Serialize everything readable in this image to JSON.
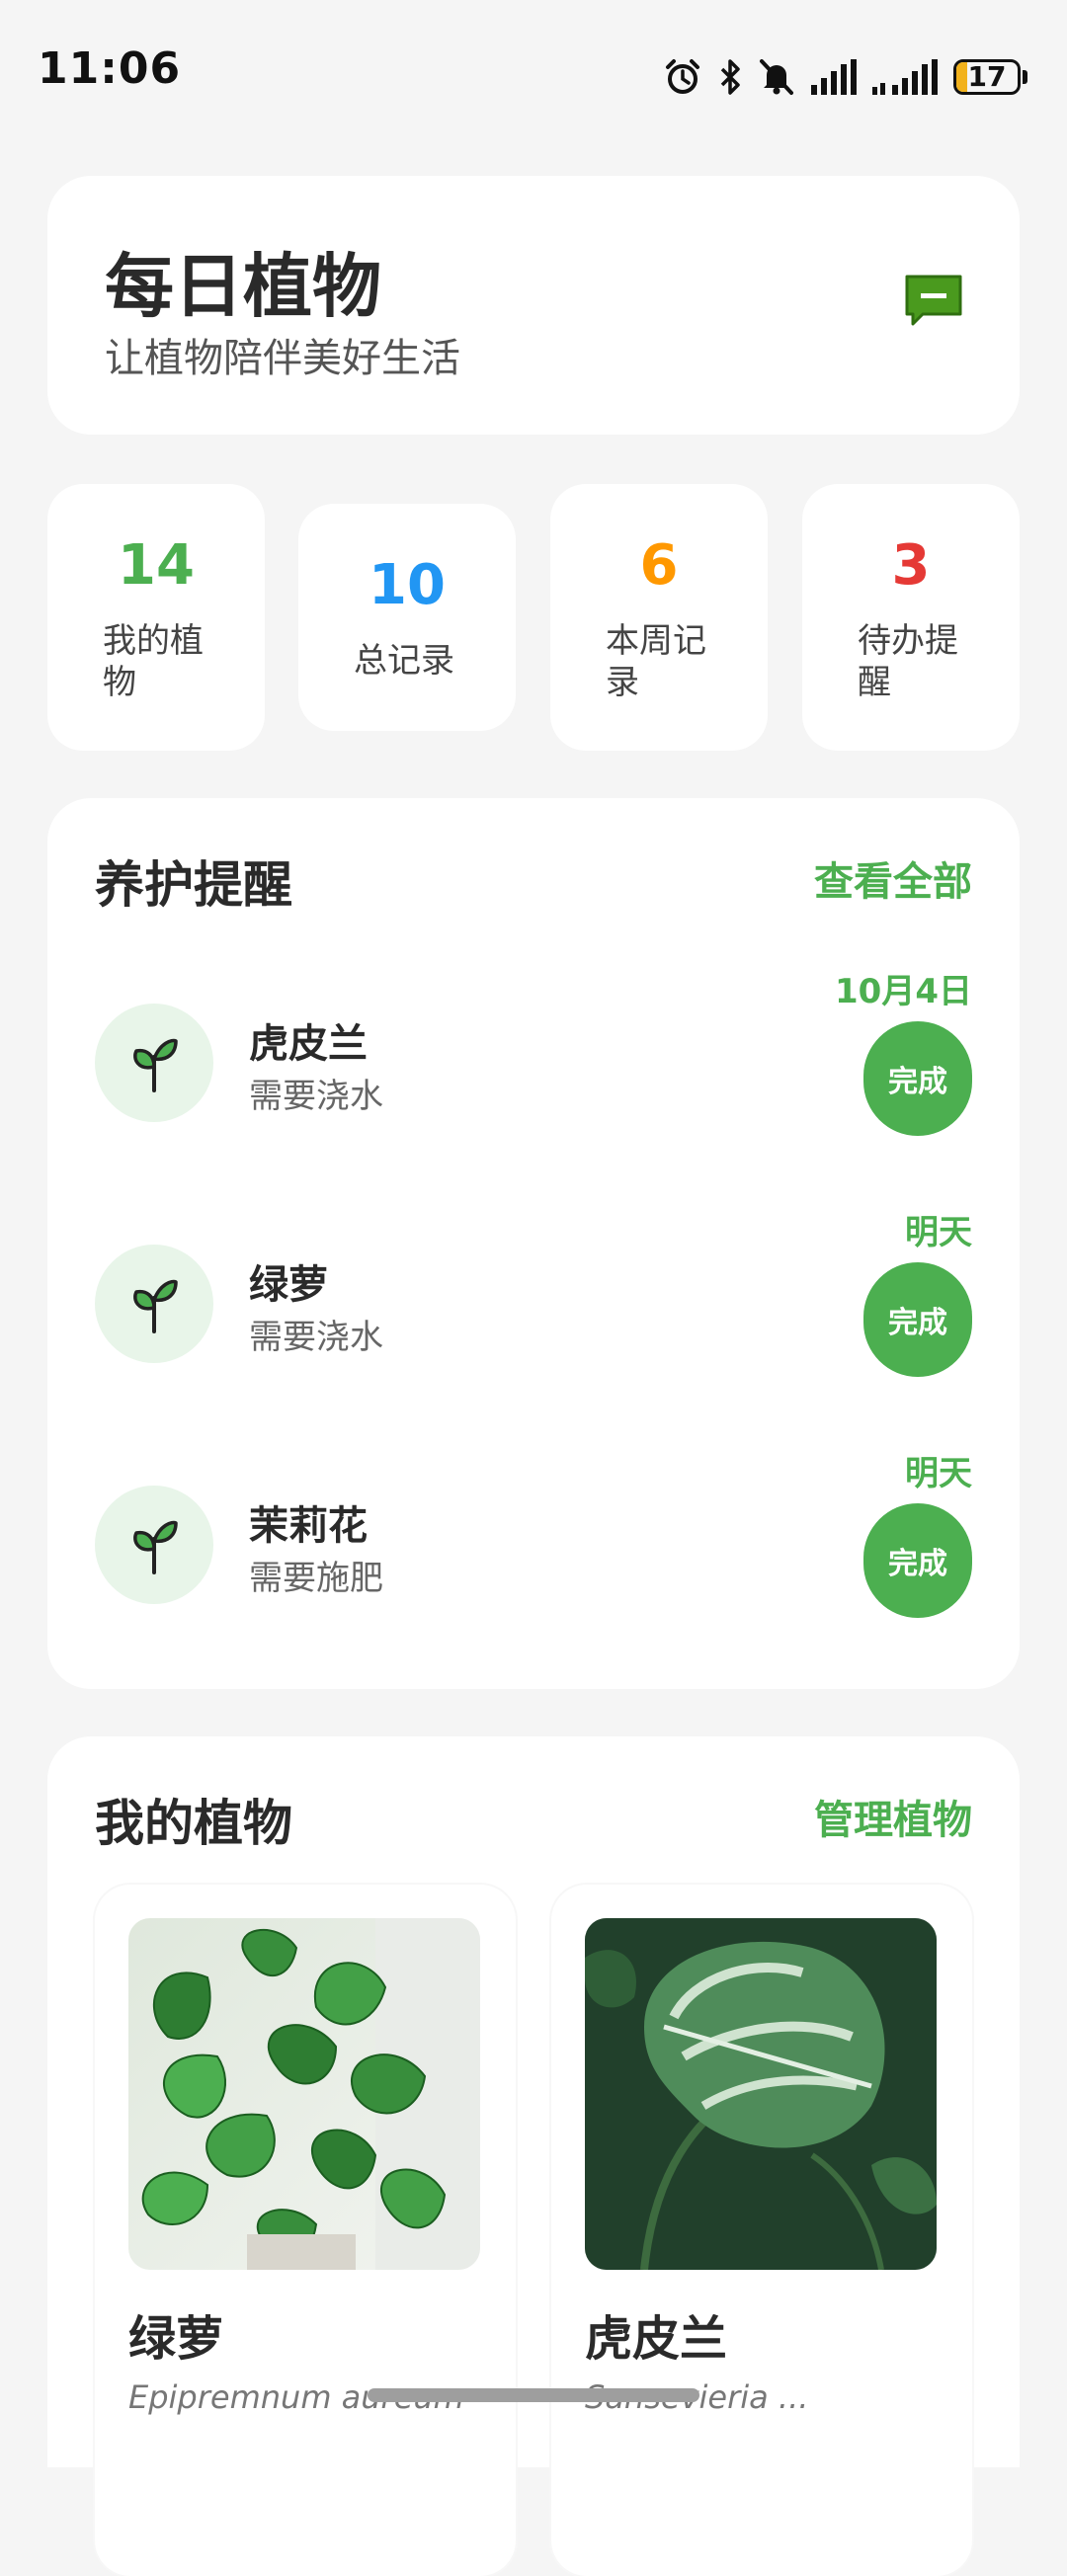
{
  "status_bar": {
    "time": "11:06",
    "battery_level": "17",
    "battery_fraction": 0.17,
    "icons": [
      "alarm-icon",
      "bluetooth-icon",
      "mute-icon",
      "signal-icon",
      "signal-icon-2",
      "battery-icon"
    ]
  },
  "header": {
    "title": "每日植物",
    "subtitle": "让植物陪伴美好生活",
    "message_icon": "message-icon"
  },
  "stats": [
    {
      "value": "14",
      "label": "我的植物",
      "color": "#4caf50"
    },
    {
      "value": "10",
      "label": "总记录",
      "color": "#2196f3"
    },
    {
      "value": "6",
      "label": "本周记录",
      "color": "#ff9800"
    },
    {
      "value": "3",
      "label": "待办提醒",
      "color": "#e53935"
    }
  ],
  "reminders": {
    "title": "养护提醒",
    "link": "查看全部",
    "items": [
      {
        "name": "虎皮兰",
        "task": "需要浇水",
        "due": "10月4日",
        "button": "完成",
        "icon": "sprout-icon"
      },
      {
        "name": "绿萝",
        "task": "需要浇水",
        "due": "明天",
        "button": "完成",
        "icon": "sprout-icon"
      },
      {
        "name": "茉莉花",
        "task": "需要施肥",
        "due": "明天",
        "button": "完成",
        "icon": "sprout-icon"
      }
    ]
  },
  "my_plants": {
    "title": "我的植物",
    "link": "管理植物",
    "items": [
      {
        "name": "绿萝",
        "latin": "Epipremnum aureum"
      },
      {
        "name": "虎皮兰",
        "latin": "Sansevieria ..."
      }
    ]
  },
  "colors": {
    "accent": "#4caf50",
    "background": "#f5f5f5"
  }
}
